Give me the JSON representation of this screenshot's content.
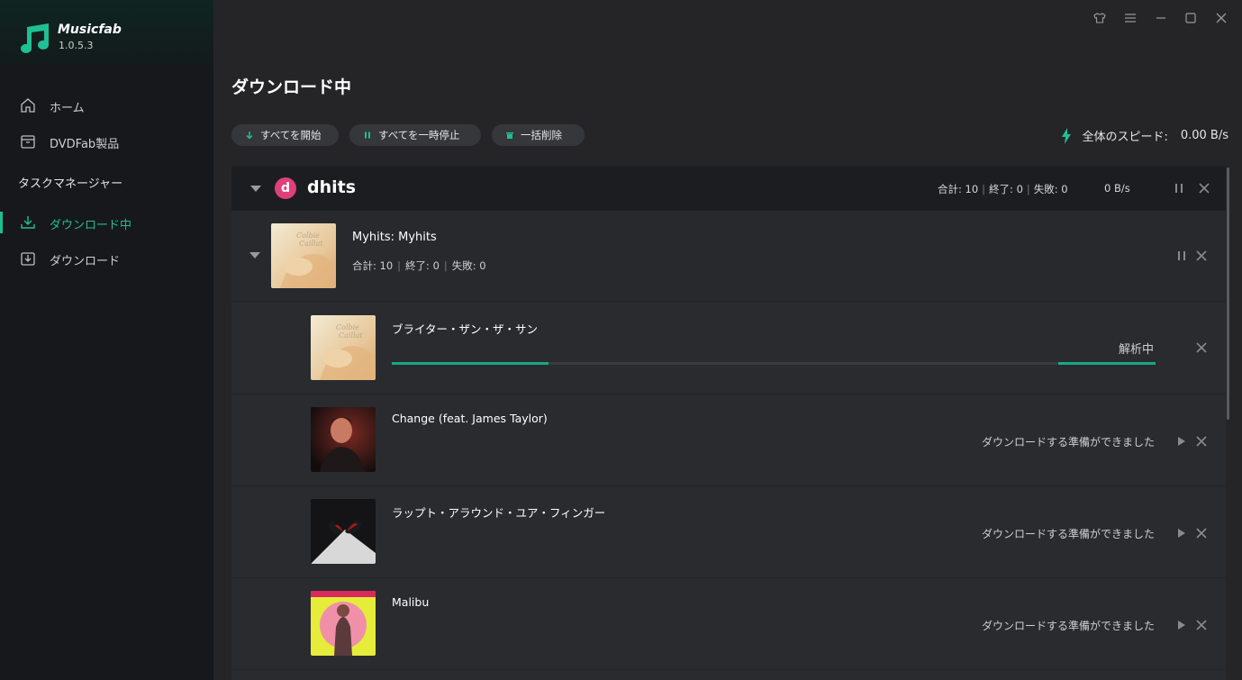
{
  "app": {
    "name": "Musicfab",
    "version": "1.0.5.3"
  },
  "sidebar": {
    "home_label": "ホーム",
    "dvdfab_label": "DVDFab製品",
    "section_label": "タスクマネージャー",
    "downloading_label": "ダウンロード中",
    "downloaded_label": "ダウンロード"
  },
  "window_controls": [
    "shirt-icon",
    "menu-icon",
    "minimize-icon",
    "maximize-icon",
    "close-icon"
  ],
  "main": {
    "title": "ダウンロード中",
    "toolbar": {
      "start_all": "すべてを開始",
      "pause_all": "すべてを一時停止",
      "delete_all": "一括削除"
    },
    "speed_label": "全体のスピード:",
    "speed_value": "0.00 B/s"
  },
  "group": {
    "badge": "d",
    "name": "dhits",
    "total": "合計: 10",
    "done": "終了: 0",
    "failed": "失敗: 0",
    "speed": "0 B/s"
  },
  "album": {
    "title": "Myhits: Myhits",
    "total": "合計: 10",
    "done": "終了: 0",
    "failed": "失敗: 0"
  },
  "tracks": [
    {
      "title": "ブライター・ザン・ザ・サン",
      "status": "解析中",
      "progress_left": 0.205,
      "progress_right": 0.127
    },
    {
      "title": "Change (feat. James Taylor)",
      "status": "ダウンロードする準備ができました"
    },
    {
      "title": "ラップト・アラウンド・ユア・フィンガー",
      "status": "ダウンロードする準備ができました"
    },
    {
      "title": "Malibu",
      "status": "ダウンロードする準備ができました"
    }
  ],
  "colors": {
    "accent": "#1fbf94",
    "badge": "#e0407a",
    "progress": "#17a884"
  }
}
